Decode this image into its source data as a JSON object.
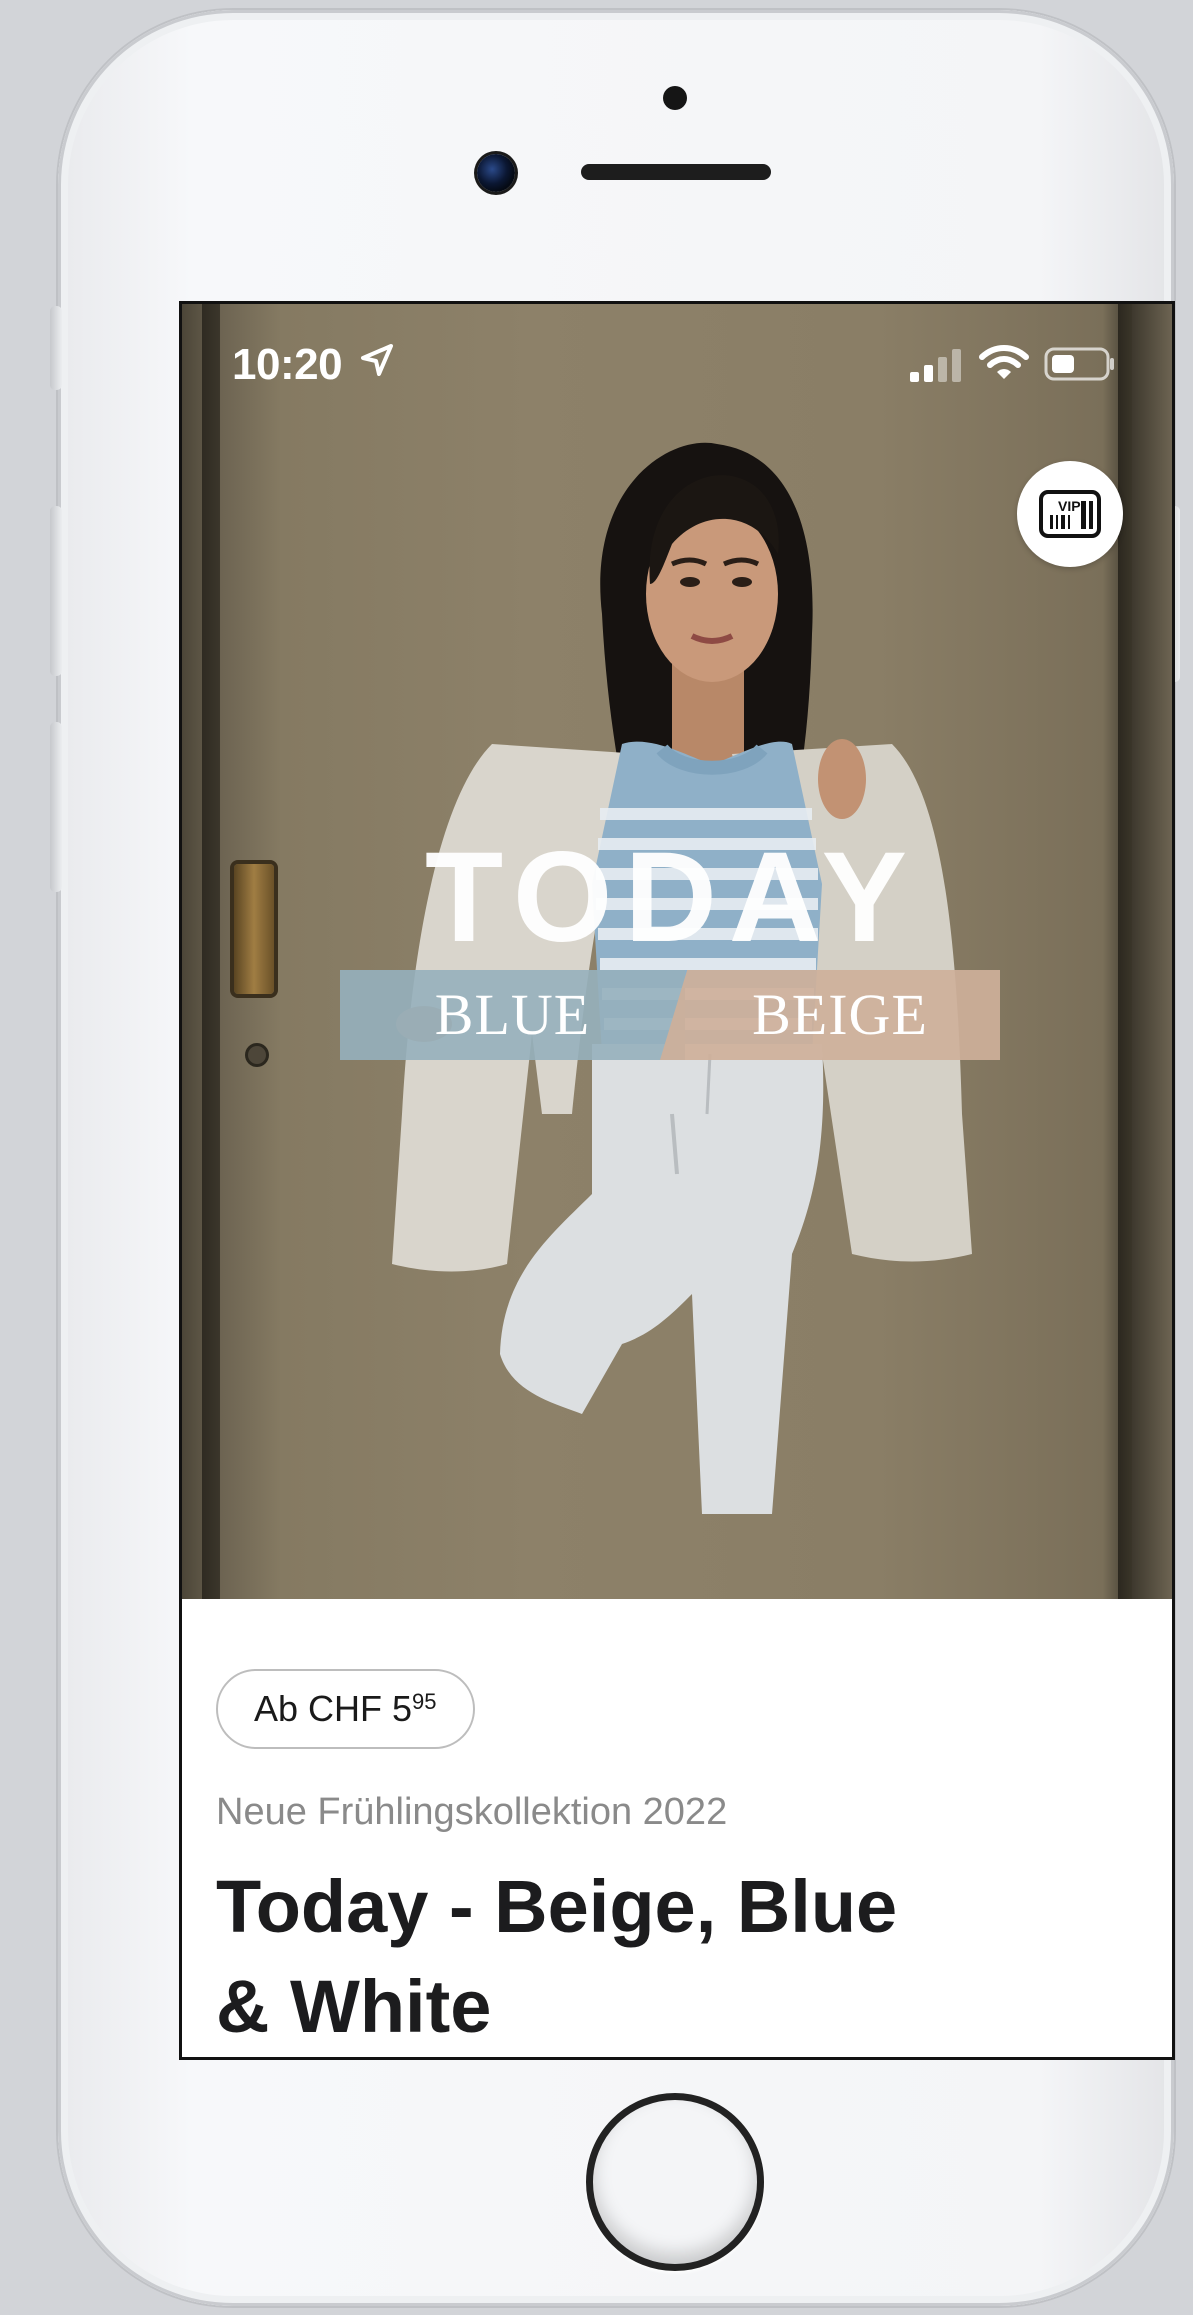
{
  "status_bar": {
    "time": "10:20",
    "location_icon": "location-arrow-icon",
    "signal_icon": "cellular-signal-icon",
    "wifi_icon": "wifi-icon",
    "battery_icon": "battery-icon"
  },
  "vip_button": {
    "icon": "vip-card-icon",
    "label": "VIP"
  },
  "hero": {
    "headline": "TODAY",
    "tag_left": "BLUE",
    "tag_right": "BEIGE"
  },
  "product": {
    "price_prefix": "Ab CHF 5",
    "price_cents": "95",
    "subtitle": "Neue Frühlingskollektion 2022",
    "title_line1": "Today - Beige, Blue",
    "title_line2": "& White"
  },
  "colors": {
    "tag_blue": "#96b0bc",
    "tag_beige": "#ceb09a",
    "title_text": "#1c1c1e",
    "subtitle_text": "#8a8a8a"
  }
}
